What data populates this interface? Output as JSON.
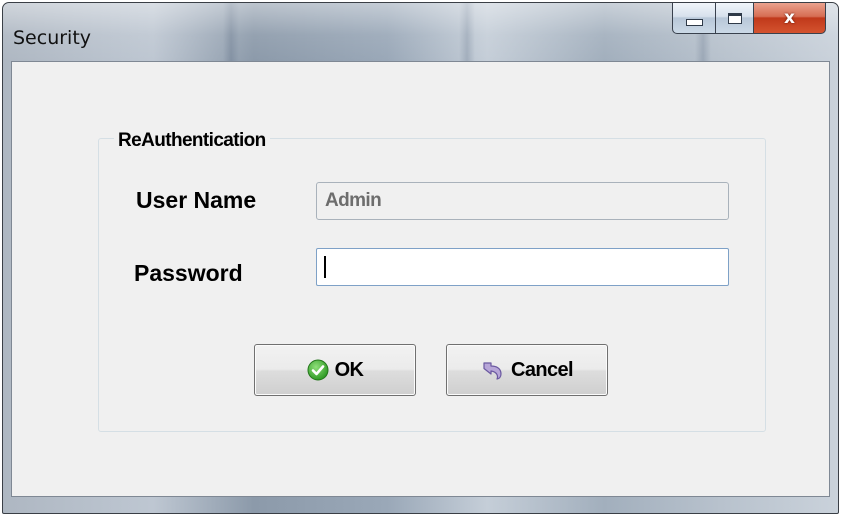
{
  "window": {
    "title": "Security",
    "controls": {
      "minimize": "minimize",
      "maximize": "maximize",
      "close_glyph": "x"
    },
    "close_color": "#c9462c"
  },
  "group": {
    "legend": "ReAuthentication"
  },
  "form": {
    "username_label": "User Name",
    "username_value": "Admin",
    "password_label": "Password",
    "password_value": ""
  },
  "buttons": {
    "ok_label": "OK",
    "ok_icon": "check-circle-icon",
    "cancel_label": "Cancel",
    "cancel_icon": "undo-arrow-icon"
  }
}
